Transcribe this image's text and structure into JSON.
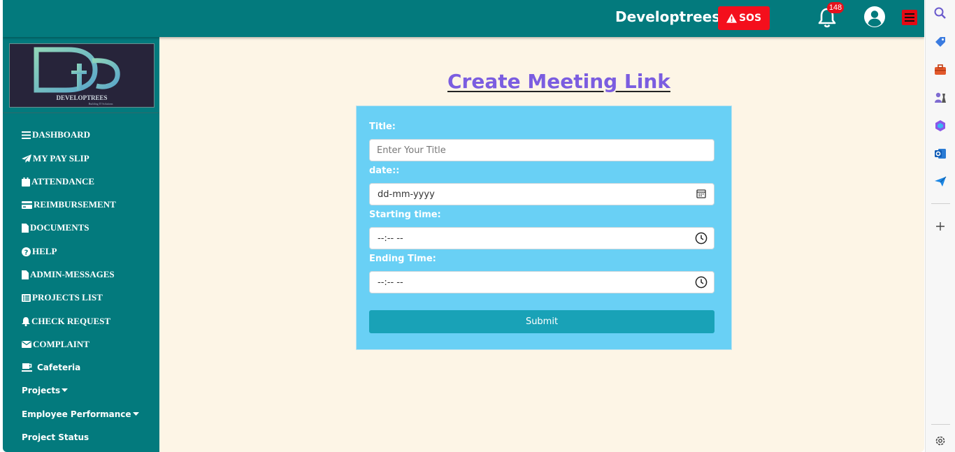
{
  "header": {
    "brand": "Developtrees",
    "sos_label": "SOS",
    "notification_count": "148"
  },
  "logo": {
    "text": "DEVELOPTREES",
    "tagline": "Building IT Solutions"
  },
  "sidebar": {
    "items": [
      {
        "label": "DASHBOARD",
        "icon": "bars-icon"
      },
      {
        "label": "MY PAY SLIP",
        "icon": "paper-plane-icon"
      },
      {
        "label": "ATTENDANCE",
        "icon": "calendar-icon"
      },
      {
        "label": "REIMBURSEMENT",
        "icon": "credit-card-icon"
      },
      {
        "label": "DOCUMENTS",
        "icon": "file-icon"
      },
      {
        "label": "HELP",
        "icon": "question-circle-icon"
      },
      {
        "label": "ADMIN-MESSAGES",
        "icon": "file-icon"
      },
      {
        "label": "PROJECTS LIST",
        "icon": "list-icon"
      },
      {
        "label": "CHECK REQUEST",
        "icon": "bell-icon"
      },
      {
        "label": "COMPLAINT",
        "icon": "envelope-icon"
      },
      {
        "label": "Cafeteria",
        "icon": "coffee-cup-icon"
      },
      {
        "label": "Projects",
        "icon": "caret-down-icon"
      },
      {
        "label": "Employee Performance",
        "icon": "caret-down-icon"
      },
      {
        "label": "Project Status",
        "icon": ""
      }
    ]
  },
  "main": {
    "title": "Create Meeting Link",
    "form": {
      "title_label": "Title:",
      "title_placeholder": "Enter Your Title",
      "date_label": "date::",
      "date_placeholder": "dd-mm-yyyy",
      "start_label": "Starting time:",
      "start_placeholder": "--:-- --",
      "end_label": "Ending Time:",
      "end_placeholder": "--:-- --",
      "submit_label": "Submit"
    }
  },
  "edge_sidebar": {
    "icons": [
      "search-icon",
      "tag-icon",
      "briefcase-icon",
      "chess-icon",
      "copilot-icon",
      "outlook-icon",
      "send-icon",
      "plus-icon",
      "gear-icon"
    ]
  },
  "colors": {
    "topbar": "#037a7d",
    "page_bg": "#fdf5e6",
    "card_bg": "#69d0f5",
    "submit_bg": "#19a2b7",
    "title_color": "#7b5de0",
    "sos_bg": "#f40f1c"
  }
}
